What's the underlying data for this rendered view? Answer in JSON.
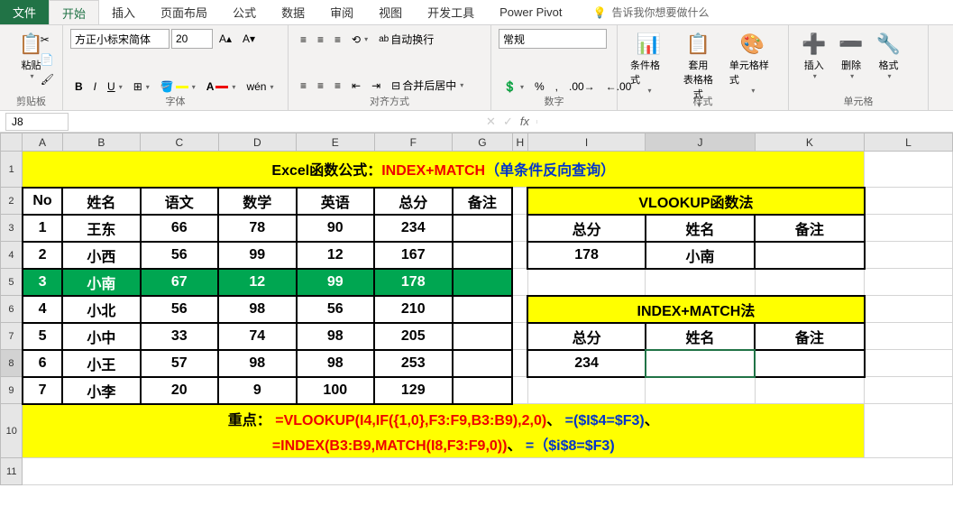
{
  "tabs": {
    "file": "文件",
    "home": "开始",
    "insert": "插入",
    "layout": "页面布局",
    "formula": "公式",
    "data": "数据",
    "review": "审阅",
    "view": "视图",
    "dev": "开发工具",
    "pivot": "Power Pivot",
    "tellme": "告诉我你想要做什么"
  },
  "ribbon": {
    "clipboard": "剪贴板",
    "paste": "粘贴",
    "font": "字体",
    "font_name": "方正小标宋简体",
    "font_size": "20",
    "align": "对齐方式",
    "wrap": "自动换行",
    "merge": "合并后居中",
    "number": "数字",
    "num_format": "常规",
    "styles": "样式",
    "cond": "条件格式",
    "tablefmt": "套用\n表格格式",
    "cellstyle": "单元格样式",
    "cells": "单元格",
    "insertc": "插入",
    "deletec": "删除",
    "formatc": "格式"
  },
  "namebox": "J8",
  "sheet": {
    "title_parts": [
      "Excel函数公式：",
      "INDEX+MATCH",
      "（单条件反向查询）"
    ],
    "headers": [
      "No",
      "姓名",
      "语文",
      "数学",
      "英语",
      "总分",
      "备注"
    ],
    "rows": [
      {
        "no": "1",
        "name": "王东",
        "c": "66",
        "m": "78",
        "e": "90",
        "t": "234",
        "r": ""
      },
      {
        "no": "2",
        "name": "小西",
        "c": "56",
        "m": "99",
        "e": "12",
        "t": "167",
        "r": ""
      },
      {
        "no": "3",
        "name": "小南",
        "c": "67",
        "m": "12",
        "e": "99",
        "t": "178",
        "r": ""
      },
      {
        "no": "4",
        "name": "小北",
        "c": "56",
        "m": "98",
        "e": "56",
        "t": "210",
        "r": ""
      },
      {
        "no": "5",
        "name": "小中",
        "c": "33",
        "m": "74",
        "e": "98",
        "t": "205",
        "r": ""
      },
      {
        "no": "6",
        "name": "小王",
        "c": "57",
        "m": "98",
        "e": "98",
        "t": "253",
        "r": ""
      },
      {
        "no": "7",
        "name": "小李",
        "c": "20",
        "m": "9",
        "e": "100",
        "t": "129",
        "r": ""
      }
    ],
    "side1": {
      "title": "VLOOKUP函数法",
      "h": [
        "总分",
        "姓名",
        "备注"
      ],
      "v": [
        "178",
        "小南",
        ""
      ]
    },
    "side2": {
      "title": "INDEX+MATCH法",
      "h": [
        "总分",
        "姓名",
        "备注"
      ],
      "v": [
        "234",
        "",
        ""
      ]
    },
    "foot1_label": "重点：",
    "foot1_a": "=VLOOKUP(I4,IF({1,0},F3:F9,B3:B9),2,0)",
    "foot1_b": "=($I$4=$F3)",
    "foot2_a": "=INDEX(B3:B9,MATCH(I8,F3:F9,0))",
    "foot2_b": "=（$i$8=$F3)",
    "sep": "、"
  },
  "cols": [
    "A",
    "B",
    "C",
    "D",
    "E",
    "F",
    "G",
    "H",
    "I",
    "J",
    "K",
    "L"
  ]
}
